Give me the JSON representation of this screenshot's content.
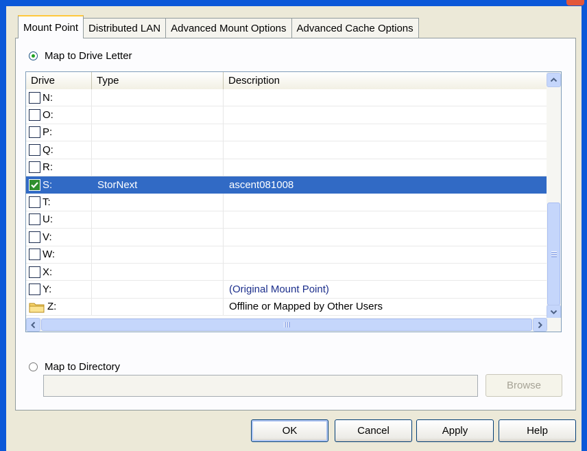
{
  "tabs": [
    {
      "label": "Mount Point",
      "active": true
    },
    {
      "label": "Distributed LAN",
      "active": false
    },
    {
      "label": "Advanced Mount Options",
      "active": false
    },
    {
      "label": "Advanced Cache Options",
      "active": false
    }
  ],
  "map_to_drive": {
    "label": "Map to Drive Letter",
    "selected": true
  },
  "listview": {
    "columns": {
      "drive": "Drive",
      "type": "Type",
      "description": "Description"
    },
    "rows": [
      {
        "drive": "N:",
        "type": "",
        "description": "",
        "checked": false
      },
      {
        "drive": "O:",
        "type": "",
        "description": "",
        "checked": false
      },
      {
        "drive": "P:",
        "type": "",
        "description": "",
        "checked": false
      },
      {
        "drive": "Q:",
        "type": "",
        "description": "",
        "checked": false
      },
      {
        "drive": "R:",
        "type": "",
        "description": "",
        "checked": false
      },
      {
        "drive": "S:",
        "type": "StorNext",
        "description": "ascent081008",
        "checked": true,
        "selected": true
      },
      {
        "drive": "T:",
        "type": "",
        "description": "",
        "checked": false
      },
      {
        "drive": "U:",
        "type": "",
        "description": "",
        "checked": false
      },
      {
        "drive": "V:",
        "type": "",
        "description": "",
        "checked": false
      },
      {
        "drive": "W:",
        "type": "",
        "description": "",
        "checked": false
      },
      {
        "drive": "X:",
        "type": "",
        "description": "",
        "checked": false
      },
      {
        "drive": "Y:",
        "type": "",
        "description": "(Original Mount Point)",
        "checked": false
      },
      {
        "drive": "Z:",
        "type": "",
        "description": "Offline or Mapped by Other Users",
        "icon": "folder-icon"
      }
    ]
  },
  "map_to_directory": {
    "label": "Map to Directory",
    "selected": false,
    "value": ""
  },
  "browse_label": "Browse",
  "buttons": {
    "ok": "OK",
    "cancel": "Cancel",
    "apply": "Apply",
    "help": "Help"
  },
  "colors": {
    "selection": "#316ac5",
    "tab_highlight": "#ffc83c",
    "title_blue": "#0b58d8"
  }
}
